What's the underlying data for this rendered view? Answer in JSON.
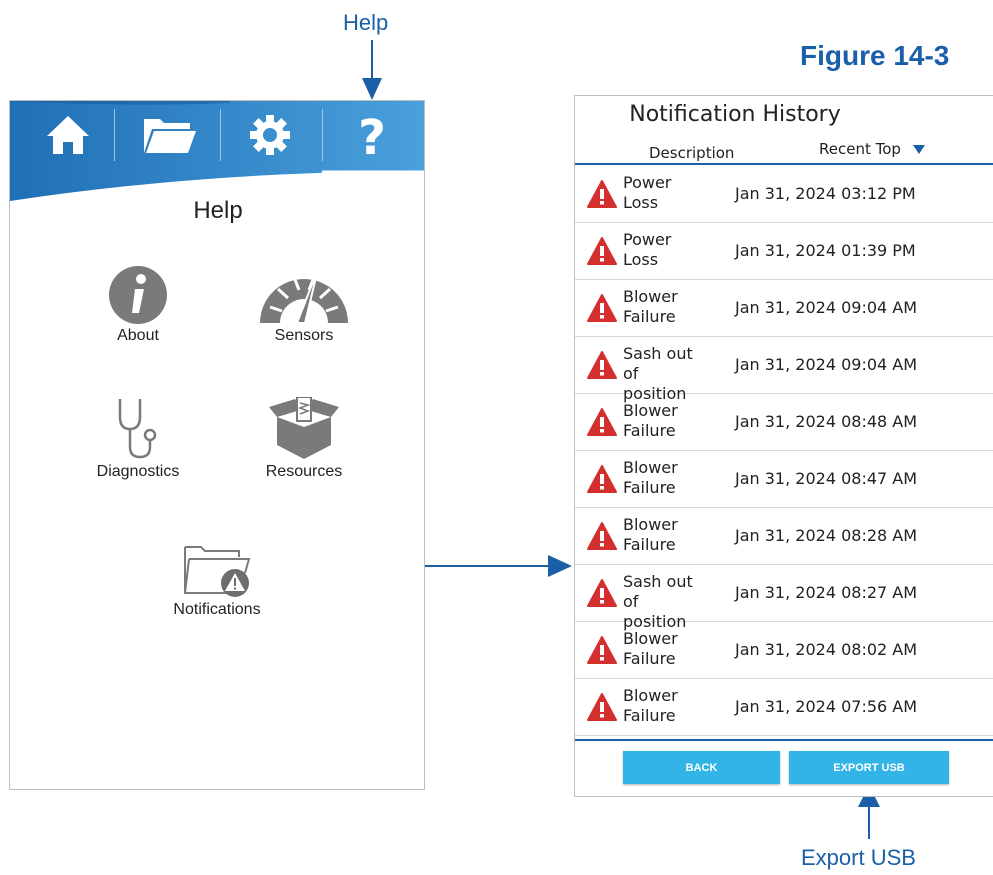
{
  "figure_label": "Figure 14-3",
  "callouts": {
    "help": "Help",
    "export_usb": "Export USB"
  },
  "left_screen": {
    "nav": [
      {
        "icon": "home-icon"
      },
      {
        "icon": "folder-icon"
      },
      {
        "icon": "gear-icon"
      },
      {
        "icon": "question-icon",
        "selected": true
      }
    ],
    "title": "Help",
    "menu": [
      {
        "label": "About",
        "icon": "info-icon"
      },
      {
        "label": "Sensors",
        "icon": "gauge-icon"
      },
      {
        "label": "Diagnostics",
        "icon": "stethoscope-icon"
      },
      {
        "label": "Resources",
        "icon": "box-icon"
      },
      {
        "label": "Notifications",
        "icon": "folder-warning-icon"
      }
    ]
  },
  "notification_history": {
    "title": "Notification History",
    "col_description": "Description",
    "col_sort": "Recent Top",
    "sort_icon": "triangle-down-icon",
    "rows": [
      {
        "description": "Power Loss",
        "timestamp": "Jan 31, 2024 03:12 PM"
      },
      {
        "description": "Power Loss",
        "timestamp": "Jan 31, 2024 01:39 PM"
      },
      {
        "description": "Blower Failure",
        "timestamp": "Jan 31, 2024 09:04 AM"
      },
      {
        "description": "Sash out of position",
        "timestamp": "Jan 31, 2024 09:04 AM"
      },
      {
        "description": "Blower Failure",
        "timestamp": "Jan 31, 2024 08:48 AM"
      },
      {
        "description": "Blower Failure",
        "timestamp": "Jan 31, 2024 08:47 AM"
      },
      {
        "description": "Blower Failure",
        "timestamp": "Jan 31, 2024 08:28 AM"
      },
      {
        "description": "Sash out of position",
        "timestamp": "Jan 31, 2024 08:27 AM"
      },
      {
        "description": "Blower Failure",
        "timestamp": "Jan 31, 2024 08:02 AM"
      },
      {
        "description": "Blower Failure",
        "timestamp": "Jan 31, 2024 07:56 AM"
      }
    ],
    "back_label": "BACK",
    "export_label": "EXPORT USB"
  },
  "colors": {
    "header_blue": "#3a8fd0",
    "annotation_blue": "#1a5fa8",
    "button_cyan": "#33b4e6",
    "warning_red": "#d32f2f",
    "icon_gray": "#777777"
  }
}
